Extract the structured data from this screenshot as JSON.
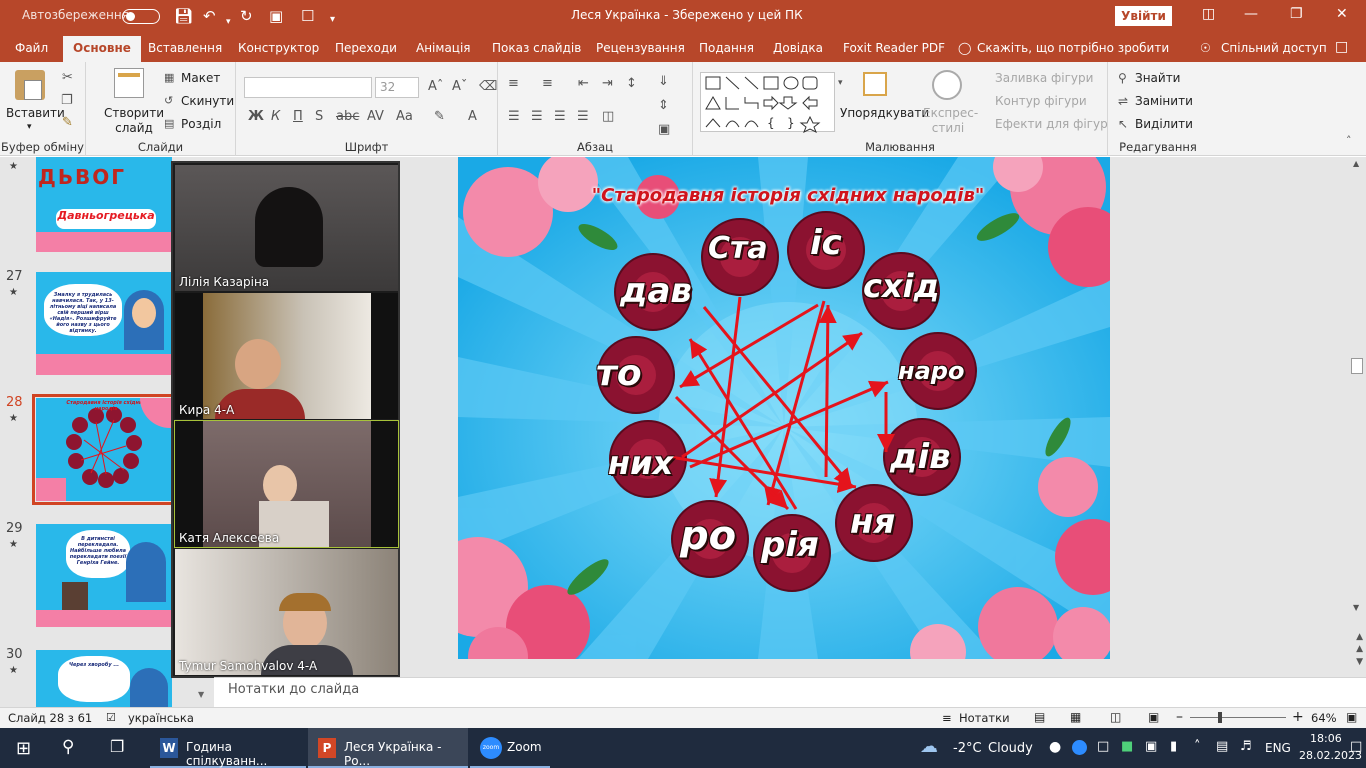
{
  "titlebar": {
    "autosave_label": "Автозбереження",
    "title": "Леся Українка  -  Збережено у цей ПК",
    "signin": "Увійти"
  },
  "tabs": [
    "Файл",
    "Основне",
    "Вставлення",
    "Конструктор",
    "Переходи",
    "Анімація",
    "Показ слайдів",
    "Рецензування",
    "Подання",
    "Довідка",
    "Foxit Reader PDF"
  ],
  "tell_me": "Скажіть, що потрібно зробити",
  "share": "Спільний доступ",
  "ribbon": {
    "clipboard": {
      "paste": "Вставити",
      "label": "Буфер обміну"
    },
    "slides": {
      "new_slide": "Створити слайд",
      "layout": "Макет",
      "reset": "Скинути",
      "section": "Розділ",
      "label": "Слайди"
    },
    "font": {
      "size": "32",
      "bold": "Ж",
      "italic": "К",
      "underline": "П",
      "strike": "S",
      "label": "Шрифт"
    },
    "paragraph": {
      "label": "Абзац"
    },
    "drawing": {
      "arrange": "Упорядкувати",
      "quick_styles": "Експрес-стилі",
      "fill": "Заливка фігури",
      "outline": "Контур фігури",
      "effects": "Ефекти для фігур",
      "label": "Малювання"
    },
    "editing": {
      "find": "Знайти",
      "replace": "Замінити",
      "select": "Виділити",
      "label": "Редагування"
    }
  },
  "thumbnails": [
    {
      "num": "",
      "caption": "Давньогрецька"
    },
    {
      "num": "27",
      "caption": "Змалку я трудилась навчилася. Так, у 13-літньому віці написала свій перший вірш «Надія». Розшифруйте його назву з цього відтинку."
    },
    {
      "num": "28",
      "caption": "Стародавня історія східних народів"
    },
    {
      "num": "29",
      "caption": "В дитинстві перекладала. Найбільше любила перекладати поезії Генріха Гейне."
    },
    {
      "num": "30",
      "caption": "Через хворобу ..."
    }
  ],
  "slide": {
    "title": "\"Стародавня історія східних народів\"",
    "words": [
      "Ста",
      "іс",
      "схід",
      "наро",
      "дів",
      "ня",
      "рія",
      "ро",
      "них",
      "то",
      "дав"
    ]
  },
  "zoom_participants": [
    {
      "name": "Лілія Казаріна"
    },
    {
      "name": "Кира 4-А"
    },
    {
      "name": "Катя Алексеева"
    },
    {
      "name": "Tymur Samohvalov 4-A"
    }
  ],
  "notes_placeholder": "Нотатки до слайда",
  "status": {
    "slide": "Слайд 28 з 61",
    "language": "українська",
    "notes": "Нотатки",
    "zoom": "64%"
  },
  "taskbar": {
    "apps": [
      "Година спілкуванн...",
      "Леся Українка - Ро...",
      "Zoom"
    ],
    "weather_temp": "-2°C",
    "weather_desc": "Cloudy",
    "lang": "ENG",
    "time": "18:06",
    "date": "28.02.2023"
  },
  "colors": {
    "accent": "#b7472a",
    "slide_bg": "#2fb6eb",
    "arrow": "#e5141c",
    "title": "#d0141c"
  }
}
